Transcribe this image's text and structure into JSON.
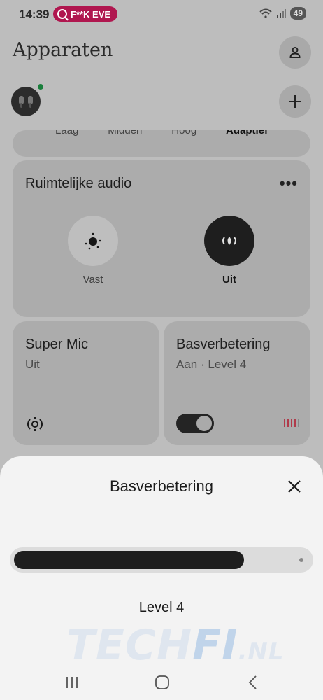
{
  "status_bar": {
    "time": "14:39",
    "notification_pill": "F**K EVE",
    "battery": "49"
  },
  "header": {
    "title": "Apparaten"
  },
  "eq_presets": {
    "items": [
      "Laag",
      "Midden",
      "Hoog",
      "Adaptief"
    ],
    "selected": "Adaptief"
  },
  "spatial_audio": {
    "title": "Ruimtelijke audio",
    "modes": [
      {
        "label": "Vast"
      },
      {
        "label": "Uit"
      }
    ],
    "selected": "Uit"
  },
  "tiles": {
    "super_mic": {
      "title": "Super Mic",
      "status": "Uit"
    },
    "bass": {
      "title": "Basverbetering",
      "status": "Aan · Level 4",
      "enabled": true
    }
  },
  "sheet": {
    "title": "Basverbetering",
    "level_label": "Level 4",
    "level_fraction": 0.78
  },
  "watermark": {
    "part1": "TECH",
    "part2": "FI",
    "part3": ".NL"
  },
  "colors": {
    "accent_dark": "#1e1e1e",
    "pill": "#b0174f",
    "online": "#1a7f3c",
    "level_bars": "#b03a4a"
  }
}
